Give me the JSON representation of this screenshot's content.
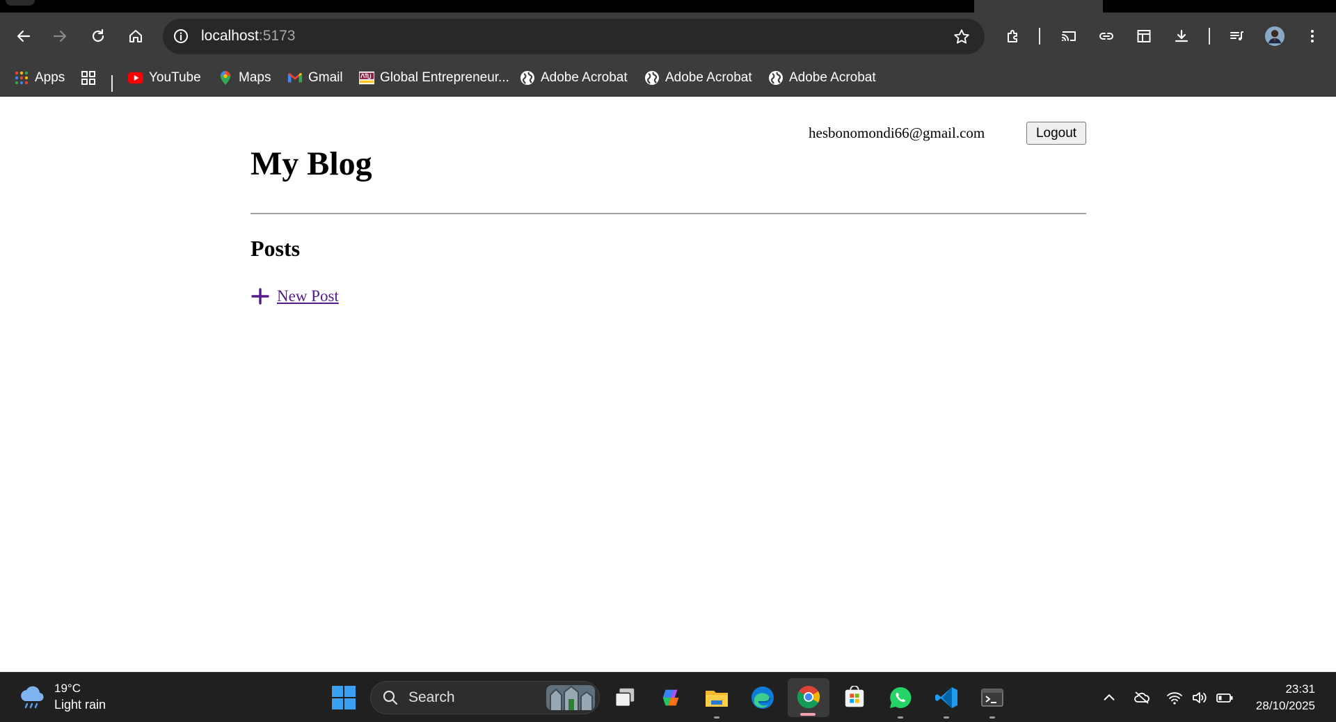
{
  "browser": {
    "url_host": "localhost",
    "url_port": ":5173",
    "bookmarks": [
      {
        "label": "Apps",
        "icon": "apps-grid-icon"
      },
      {
        "label": "YouTube",
        "icon": "youtube-icon"
      },
      {
        "label": "Maps",
        "icon": "maps-pin-icon"
      },
      {
        "label": "Gmail",
        "icon": "gmail-icon"
      },
      {
        "label": "Global Entrepreneur...",
        "icon": "asu-icon"
      },
      {
        "label": "Adobe Acrobat",
        "icon": "globe-icon"
      },
      {
        "label": "Adobe Acrobat",
        "icon": "globe-icon"
      },
      {
        "label": "Adobe Acrobat",
        "icon": "globe-icon"
      }
    ]
  },
  "page": {
    "user_email": "hesbonomondi66@gmail.com",
    "logout_label": "Logout",
    "title": "My Blog",
    "section_title": "Posts",
    "new_post_label": "New Post",
    "link_color": "#551a8b"
  },
  "taskbar": {
    "weather_temp": "19°C",
    "weather_condition": "Light rain",
    "search_placeholder": "Search",
    "time": "23:31",
    "date": "28/10/2025"
  }
}
